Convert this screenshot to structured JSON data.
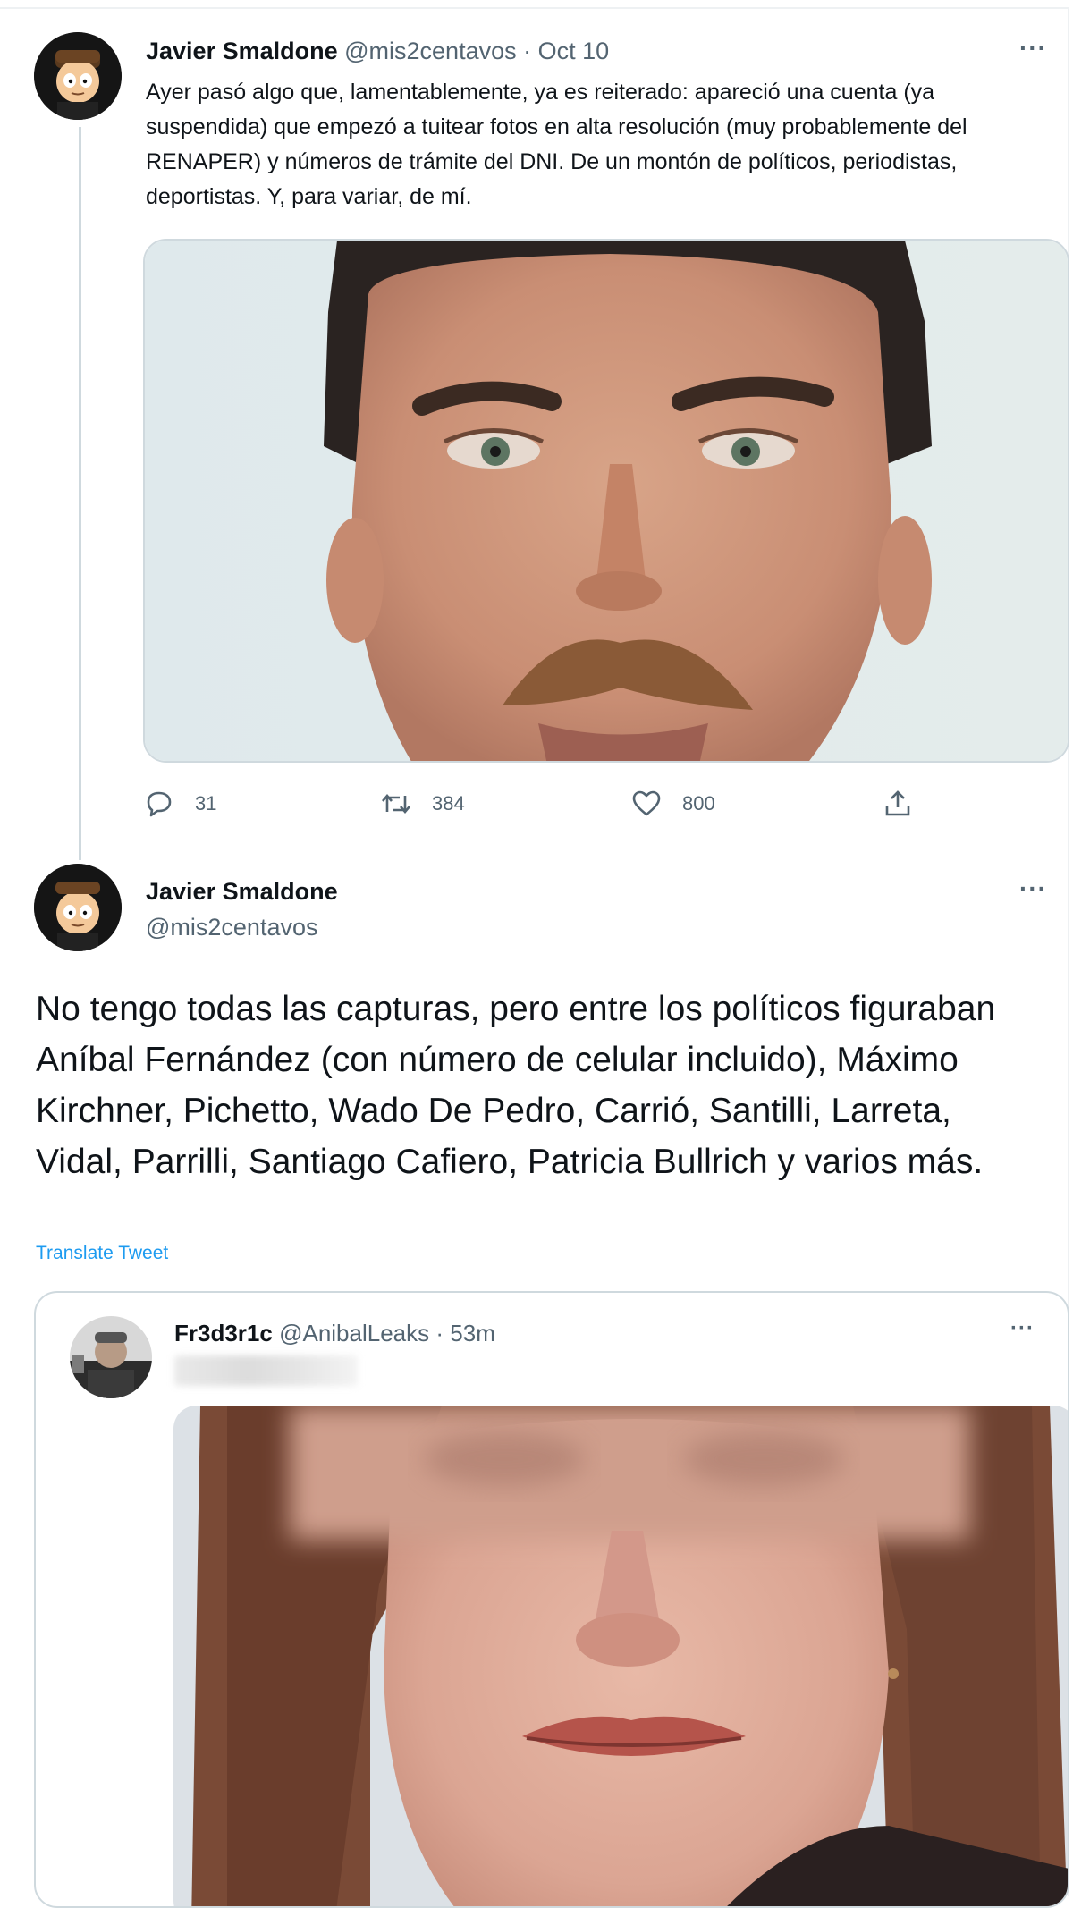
{
  "tweet1": {
    "author_name": "Javier Smaldone",
    "handle": "@mis2centavos",
    "separator": "·",
    "date": "Oct 10",
    "more_label": "···",
    "text": "Ayer pasó algo que, lamentablemente, ya es reiterado: apareció una cuenta (ya suspendida) que empezó a tuitear fotos en alta resolución (muy probablemente del RENAPER) y números de trámite del DNI. De un montón de políticos, periodistas, deportistas. Y, para variar, de mí.",
    "actions": {
      "reply_count": "31",
      "retweet_count": "384",
      "like_count": "800"
    },
    "icons": [
      "reply-icon",
      "retweet-icon",
      "like-icon",
      "share-icon"
    ]
  },
  "tweet2": {
    "author_name": "Javier Smaldone",
    "handle": "@mis2centavos",
    "more_label": "···",
    "text": "No tengo todas las capturas, pero entre los políticos figuraban Aníbal Fernández (con número de celular incluido), Máximo Kirchner, Pichetto, Wado De Pedro, Carrió, Santilli, Larreta, Vidal, Parrilli, Santiago Cafiero, Patricia Bullrich y varios más.",
    "translate_label": "Translate Tweet"
  },
  "quoted": {
    "author_name": "Fr3d3r1c",
    "handle": "@AnibalLeaks",
    "separator": "·",
    "time": "53m",
    "more_label": "···"
  },
  "colors": {
    "text": "#0f1419",
    "muted": "#536471",
    "border": "#cfd9de",
    "link": "#1d9bf0"
  }
}
